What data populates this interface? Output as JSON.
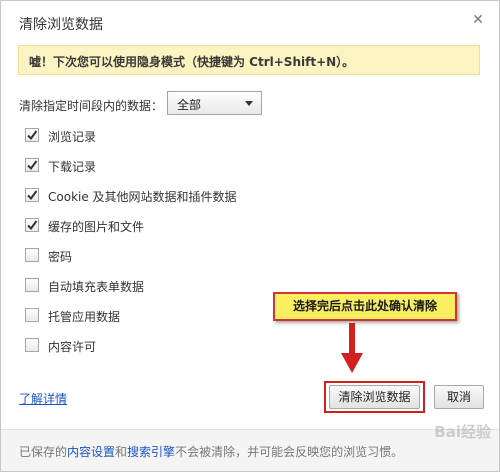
{
  "dialog": {
    "title": "清除浏览数据",
    "close_glyph": "✕"
  },
  "notice": "嘘！下次您可以使用隐身模式（快捷键为 Ctrl+Shift+N）。",
  "time_range": {
    "label": "清除指定时间段内的数据：",
    "selected": "全部"
  },
  "options": [
    {
      "label": "浏览记录",
      "checked": true
    },
    {
      "label": "下载记录",
      "checked": true
    },
    {
      "label": "Cookie 及其他网站数据和插件数据",
      "checked": true
    },
    {
      "label": "缓存的图片和文件",
      "checked": true
    },
    {
      "label": "密码",
      "checked": false
    },
    {
      "label": "自动填充表单数据",
      "checked": false
    },
    {
      "label": "托管应用数据",
      "checked": false
    },
    {
      "label": "内容许可",
      "checked": false
    }
  ],
  "annotation": {
    "text": "选择完后点击此处确认清除"
  },
  "links": {
    "learn_more": "了解详情"
  },
  "buttons": {
    "clear": "清除浏览数据",
    "cancel": "取消"
  },
  "footer": {
    "prefix": "已保存的",
    "content_settings": "内容设置",
    "and": "和",
    "search_engines": "搜索引擎",
    "suffix": "不会被清除，并可能会反映您的浏览习惯。"
  },
  "watermark": "Bai经验",
  "colors": {
    "notice_bg": "#fbf3c2",
    "callout_bg": "#f9ee60",
    "highlight_red": "#d21f1f",
    "link_blue": "#1a56c4"
  }
}
